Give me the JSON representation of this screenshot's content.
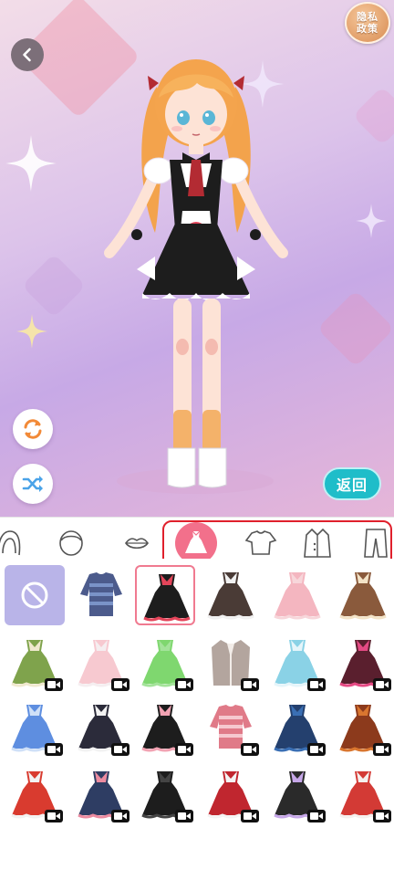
{
  "header": {
    "privacy_label": "隐私政策",
    "back_icon": "chevron-left-icon"
  },
  "stage": {
    "return_label": "返回",
    "reset_icon": "refresh-icon",
    "random_icon": "shuffle-icon"
  },
  "tabs": [
    {
      "icon": "hair-icon",
      "selected": false
    },
    {
      "icon": "face-icon",
      "selected": false
    },
    {
      "icon": "mouth-icon",
      "selected": false
    },
    {
      "icon": "dress-icon",
      "selected": true
    },
    {
      "icon": "top-icon",
      "selected": false
    },
    {
      "icon": "jacket-icon",
      "selected": false
    },
    {
      "icon": "pants-icon",
      "selected": false
    }
  ],
  "items": [
    {
      "kind": "none",
      "colors": [],
      "video": false
    },
    {
      "kind": "sweater",
      "colors": [
        "#4c5b8c",
        "#7a93c8"
      ],
      "video": false
    },
    {
      "kind": "maid",
      "colors": [
        "#1d1d1d",
        "#e4455a"
      ],
      "video": false,
      "selected": true
    },
    {
      "kind": "dress",
      "colors": [
        "#4a3b36",
        "#f1f1f1"
      ],
      "video": false
    },
    {
      "kind": "dress",
      "colors": [
        "#f4b6c0",
        "#f7d6da"
      ],
      "video": false
    },
    {
      "kind": "dress",
      "colors": [
        "#8a5a3c",
        "#f3e3c7"
      ],
      "video": false
    },
    {
      "kind": "dress",
      "colors": [
        "#7fa34c",
        "#f0e9cf"
      ],
      "video": true
    },
    {
      "kind": "dress",
      "colors": [
        "#f7c9d0",
        "#f5eef0"
      ],
      "video": true
    },
    {
      "kind": "dress",
      "colors": [
        "#7fd76f",
        "#a4e39a"
      ],
      "video": true
    },
    {
      "kind": "coat",
      "colors": [
        "#b3a59e",
        "#f2ece8"
      ],
      "video": true
    },
    {
      "kind": "dress",
      "colors": [
        "#8ad2e6",
        "#e5f5fa"
      ],
      "video": true
    },
    {
      "kind": "dress",
      "colors": [
        "#5a1f2e",
        "#e54a84"
      ],
      "video": true
    },
    {
      "kind": "dress",
      "colors": [
        "#5e8ee0",
        "#cfe0f7"
      ],
      "video": true
    },
    {
      "kind": "dress",
      "colors": [
        "#2b2b3a",
        "#f2f2f2"
      ],
      "video": true
    },
    {
      "kind": "dress",
      "colors": [
        "#1d1d1d",
        "#f2a3b3"
      ],
      "video": true
    },
    {
      "kind": "sweater",
      "colors": [
        "#e07a88",
        "#f6c8cf"
      ],
      "video": true
    },
    {
      "kind": "dress",
      "colors": [
        "#24406e",
        "#3a6fb4"
      ],
      "video": true
    },
    {
      "kind": "dress",
      "colors": [
        "#8c3a1c",
        "#d9762f"
      ],
      "video": true
    },
    {
      "kind": "dress",
      "colors": [
        "#d93b2f",
        "#f2f2f2"
      ],
      "video": true
    },
    {
      "kind": "dress",
      "colors": [
        "#2e3d63",
        "#ec8ba0"
      ],
      "video": true
    },
    {
      "kind": "dress",
      "colors": [
        "#1d1d1d",
        "#444444"
      ],
      "video": true
    },
    {
      "kind": "dress",
      "colors": [
        "#c0262f",
        "#f4f4f4"
      ],
      "video": true
    },
    {
      "kind": "dress",
      "colors": [
        "#2a2a2a",
        "#c6a7e8"
      ],
      "video": true
    },
    {
      "kind": "dress",
      "colors": [
        "#d33a35",
        "#f5f0ee"
      ],
      "video": true
    }
  ],
  "colors": {
    "accent_pink": "#f2708b",
    "highlight_red": "#e0202c",
    "return_teal": "#1fbdc9",
    "none_cell": "#b9b4e8"
  }
}
